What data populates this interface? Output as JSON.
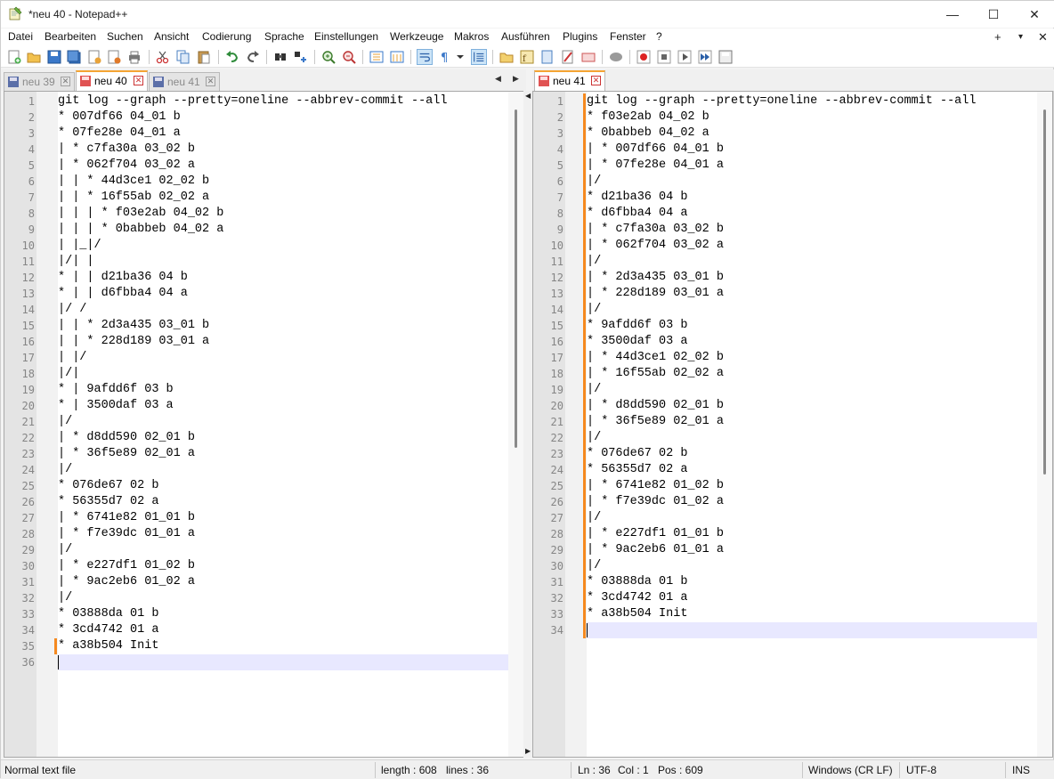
{
  "window": {
    "title": "*neu 40 - Notepad++"
  },
  "menu": [
    "Datei",
    "Bearbeiten",
    "Suchen",
    "Ansicht",
    "Codierung",
    "Sprache",
    "Einstellungen",
    "Werkzeuge",
    "Makros",
    "Ausführen",
    "Plugins",
    "Fenster",
    "?"
  ],
  "menu_right": {
    "add": "+",
    "dropdown": "▾",
    "close": "✕"
  },
  "window_controls": {
    "minimize": "—",
    "maximize": "☐",
    "close": "✕"
  },
  "left_tabs": [
    {
      "label": "neu 39",
      "active": false
    },
    {
      "label": "neu 40",
      "active": true
    },
    {
      "label": "neu 41",
      "active": false
    }
  ],
  "right_tabs": [
    {
      "label": "neu 41",
      "active": true
    }
  ],
  "tab_nav": {
    "prev": "◀",
    "next": "▶"
  },
  "left_editor": {
    "lines": [
      "git log --graph --pretty=oneline --abbrev-commit --all",
      "* 007df66 04_01 b",
      "* 07fe28e 04_01 a",
      "| * c7fa30a 03_02 b",
      "| * 062f704 03_02 a",
      "| | * 44d3ce1 02_02 b",
      "| | * 16f55ab 02_02 a",
      "| | | * f03e2ab 04_02 b",
      "| | | * 0babbeb 04_02 a",
      "| |_|/",
      "|/| |",
      "* | | d21ba36 04 b",
      "* | | d6fbba4 04 a",
      "|/ /",
      "| | * 2d3a435 03_01 b",
      "| | * 228d189 03_01 a",
      "| |/",
      "|/|",
      "* | 9afdd6f 03 b",
      "* | 3500daf 03 a",
      "|/",
      "| * d8dd590 02_01 b",
      "| * 36f5e89 02_01 a",
      "|/",
      "* 076de67 02 b",
      "* 56355d7 02 a",
      "| * 6741e82 01_01 b",
      "| * f7e39dc 01_01 a",
      "|/",
      "| * e227df1 01_02 b",
      "| * 9ac2eb6 01_02 a",
      "|/",
      "* 03888da 01 b",
      "* 3cd4742 01 a",
      "* a38b504 Init",
      ""
    ],
    "current_line": 36,
    "changed_line": 35
  },
  "right_editor": {
    "lines": [
      "git log --graph --pretty=oneline --abbrev-commit --all",
      "* f03e2ab 04_02 b",
      "* 0babbeb 04_02 a",
      "| * 007df66 04_01 b",
      "| * 07fe28e 04_01 a",
      "|/",
      "* d21ba36 04 b",
      "* d6fbba4 04 a",
      "| * c7fa30a 03_02 b",
      "| * 062f704 03_02 a",
      "|/",
      "| * 2d3a435 03_01 b",
      "| * 228d189 03_01 a",
      "|/",
      "* 9afdd6f 03 b",
      "* 3500daf 03 a",
      "| * 44d3ce1 02_02 b",
      "| * 16f55ab 02_02 a",
      "|/",
      "| * d8dd590 02_01 b",
      "| * 36f5e89 02_01 a",
      "|/",
      "* 076de67 02 b",
      "* 56355d7 02 a",
      "| * 6741e82 01_02 b",
      "| * f7e39dc 01_02 a",
      "|/",
      "| * e227df1 01_01 b",
      "| * 9ac2eb6 01_01 a",
      "|/",
      "* 03888da 01 b",
      "* 3cd4742 01 a",
      "* a38b504 Init",
      ""
    ],
    "current_line": 34,
    "changed_lines_from": 1,
    "changed_lines_to": 34
  },
  "status": {
    "file_type": "Normal text file",
    "length": "length : 608",
    "lines": "lines : 36",
    "ln": "Ln : 36",
    "col": "Col : 1",
    "pos": "Pos : 609",
    "eol": "Windows (CR LF)",
    "encoding": "UTF-8",
    "mode": "INS"
  },
  "colors": {
    "accent_tab": "#f5a433",
    "change_marker": "#f5891f",
    "current_line_bg": "#e8e8ff"
  }
}
